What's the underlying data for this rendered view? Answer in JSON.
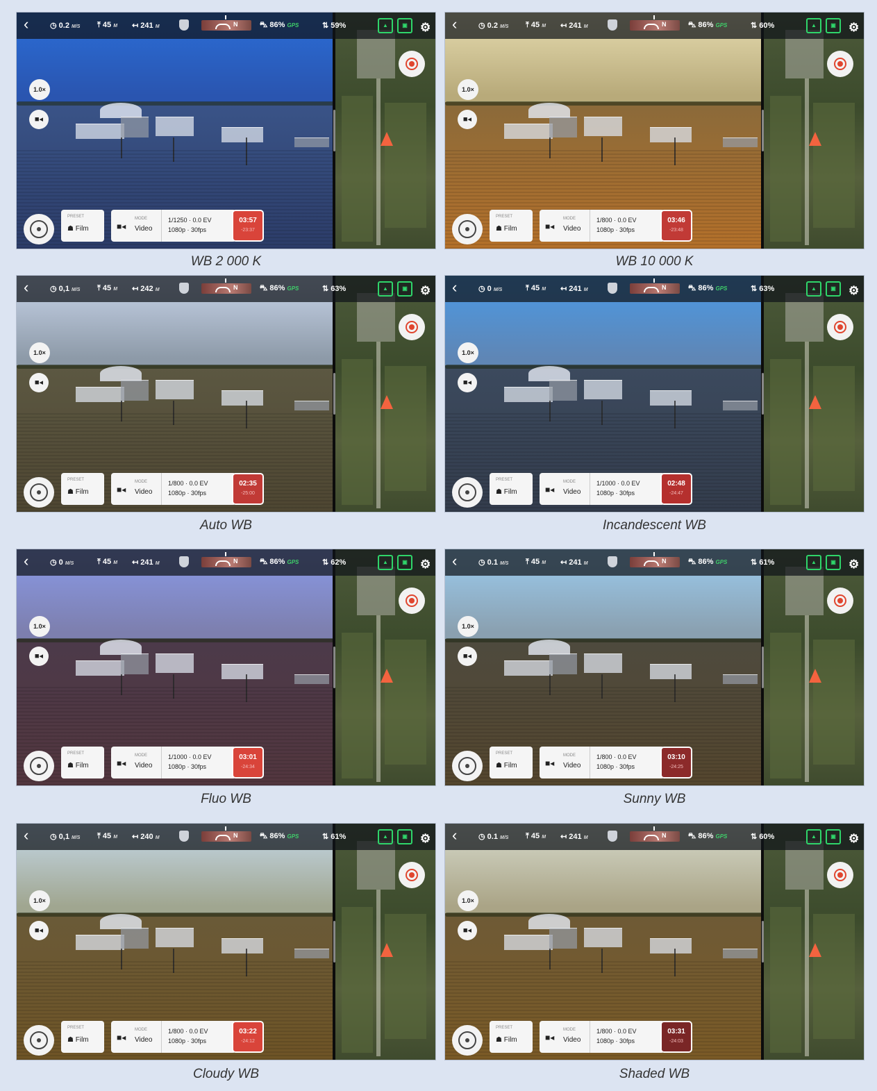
{
  "common": {
    "altitude": "45",
    "altitude_unit": "M",
    "speed_unit": "M/S",
    "distance_unit": "M",
    "drone_battery": "86%",
    "gps_label": "GPS",
    "compass_heading": "N",
    "zoom": "1.0×",
    "preset_label": "PRESET",
    "preset_value": "Film",
    "mode_label": "MODE",
    "mode_value": "Video",
    "video_format": "1080p · 30fps",
    "icons": [
      "back-icon",
      "speed-icon",
      "altitude-icon",
      "distance-icon",
      "shield-icon",
      "drone-battery-icon",
      "signal-icon",
      "gear-icon",
      "target-icon",
      "drone-arrow-icon",
      "joystick-icon",
      "turtle-icon",
      "video-camera-icon",
      "camera-toggle-icon"
    ]
  },
  "panels": [
    {
      "caption": "WB 2 000 K",
      "speed": "0.2",
      "distance": "241",
      "battery": "59%",
      "shutter": "1/1250 · 0.0 EV",
      "rec_time": "03:57",
      "rec_remaining": "-23:37",
      "rec_color": "#d9443a",
      "colors": {
        "sky": "#2b6ed8",
        "horizon": "#2a55b0",
        "ground_top": "#3a5488",
        "ground_bottom": "#2c3c68"
      }
    },
    {
      "caption": "WB 10 000 K",
      "speed": "0.2",
      "distance": "241",
      "battery": "60%",
      "shutter": "1/800 · 0.0 EV",
      "rec_time": "03:46",
      "rec_remaining": "-23:48",
      "rec_color": "#c13a36",
      "colors": {
        "sky": "#e6dcb0",
        "horizon": "#b8aa7a",
        "ground_top": "#8a6a3a",
        "ground_bottom": "#b4702a"
      }
    },
    {
      "caption": "Auto WB",
      "speed": "0,1",
      "distance": "242",
      "battery": "63%",
      "shutter": "1/800 · 0.0 EV",
      "rec_time": "02:35",
      "rec_remaining": "-25:00",
      "rec_color": "#c13a36",
      "colors": {
        "sky": "#c9d5ea",
        "horizon": "#8d9aa8",
        "ground_top": "#5c5842",
        "ground_bottom": "#4e4632"
      }
    },
    {
      "caption": "Incandescent WB",
      "speed": "0",
      "distance": "241",
      "battery": "63%",
      "shutter": "1/1000 · 0.0 EV",
      "rec_time": "02:48",
      "rec_remaining": "-24:47",
      "rec_color": "#b5302e",
      "colors": {
        "sky": "#4a9ae6",
        "horizon": "#5f86b5",
        "ground_top": "#3c4a5e",
        "ground_bottom": "#333c4c"
      }
    },
    {
      "caption": "Fluo WB",
      "speed": "0",
      "distance": "241",
      "battery": "62%",
      "shutter": "1/1000 · 0.0 EV",
      "rec_time": "03:01",
      "rec_remaining": "-24:34",
      "rec_color": "#d9443a",
      "colors": {
        "sky": "#8a9ae8",
        "horizon": "#7d7fae",
        "ground_top": "#4c3a4a",
        "ground_bottom": "#52363e"
      }
    },
    {
      "caption": "Sunny WB",
      "speed": "0.1",
      "distance": "241",
      "battery": "61%",
      "shutter": "1/800 · 0.0 EV",
      "rec_time": "03:10",
      "rec_remaining": "-24:25",
      "rec_color": "#8c2a2a",
      "colors": {
        "sky": "#9ccdf0",
        "horizon": "#8aa0b0",
        "ground_top": "#4e4a3e",
        "ground_bottom": "#54462e"
      }
    },
    {
      "caption": "Cloudy WB",
      "speed": "0,1",
      "distance": "240",
      "battery": "61%",
      "shutter": "1/800 · 0.0 EV",
      "rec_time": "03:22",
      "rec_remaining": "-24:12",
      "rec_color": "#d9443a",
      "colors": {
        "sky": "#c5d8e8",
        "horizon": "#a0a690",
        "ground_top": "#6a5a38",
        "ground_bottom": "#6e5426"
      }
    },
    {
      "caption": "Shaded WB",
      "speed": "0.1",
      "distance": "241",
      "battery": "60%",
      "shutter": "1/800 · 0.0 EV",
      "rec_time": "03:31",
      "rec_remaining": "-24:03",
      "rec_color": "#7a2626",
      "colors": {
        "sky": "#d6dacc",
        "horizon": "#aaa486",
        "ground_top": "#6e5a36",
        "ground_bottom": "#7a5a26"
      }
    }
  ]
}
